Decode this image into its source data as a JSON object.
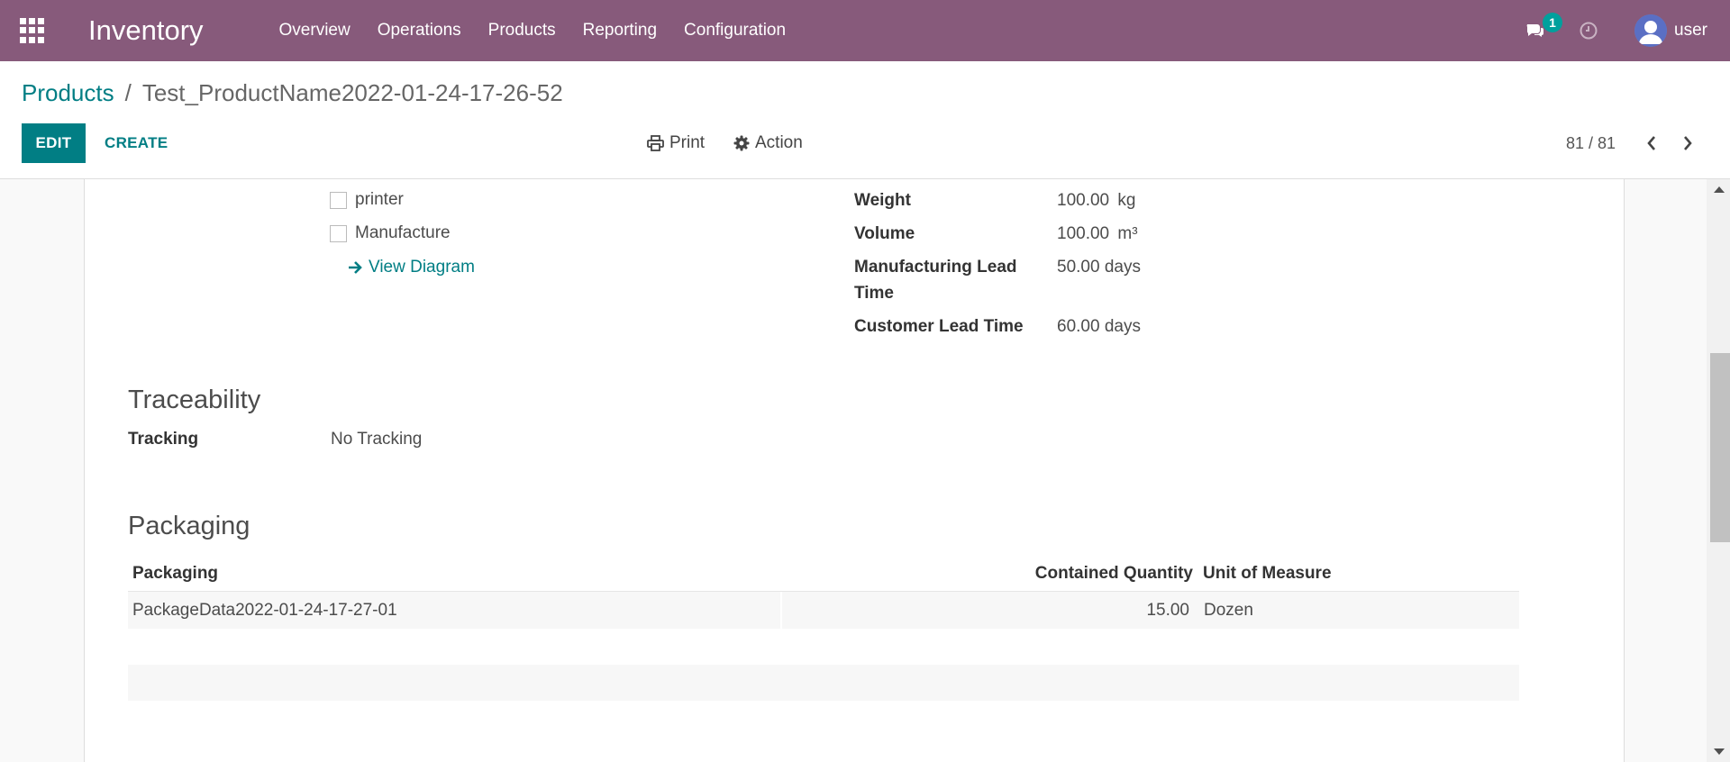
{
  "navbar": {
    "app_title": "Inventory",
    "menu": [
      "Overview",
      "Operations",
      "Products",
      "Reporting",
      "Configuration"
    ],
    "chat_badge": "1",
    "user_name": "user"
  },
  "breadcrumb": {
    "parent": "Products",
    "separator": "/",
    "current": "Test_ProductName2022-01-24-17-26-52"
  },
  "toolbar": {
    "edit_label": "EDIT",
    "create_label": "CREATE",
    "print_label": "Print",
    "action_label": "Action",
    "pager": "81 / 81"
  },
  "routes": {
    "printer_label": "printer",
    "manufacture_label": "Manufacture",
    "view_diagram_label": "View Diagram"
  },
  "logistics": {
    "weight_label": "Weight",
    "weight_value": "100.00",
    "weight_unit": "kg",
    "volume_label": "Volume",
    "volume_value": "100.00",
    "volume_unit": "m³",
    "mfg_lead_label_line1": "Manufacturing Lead",
    "mfg_lead_label_line2": "Time",
    "mfg_lead_value": "50.00 days",
    "customer_lead_label": "Customer Lead Time",
    "customer_lead_value": "60.00 days"
  },
  "traceability": {
    "title": "Traceability",
    "tracking_label": "Tracking",
    "tracking_value": "No Tracking"
  },
  "packaging": {
    "title": "Packaging",
    "columns": {
      "packaging": "Packaging",
      "contained_quantity": "Contained Quantity",
      "unit_of_measure": "Unit of Measure"
    },
    "rows": [
      {
        "packaging": "PackageData2022-01-24-17-27-01",
        "quantity": "15.00",
        "uom": "Dozen"
      }
    ]
  },
  "colors": {
    "navbar": "#875a7b",
    "primary": "#017e84",
    "badge": "#00a09d"
  }
}
